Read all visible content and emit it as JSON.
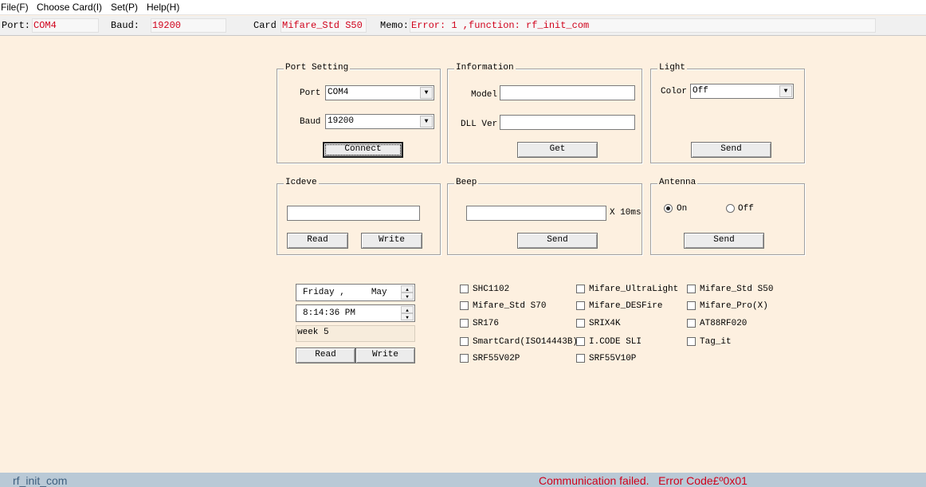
{
  "menu": [
    "File(F)",
    "Choose Card(I)",
    "Set(P)",
    "Help(H)"
  ],
  "status": {
    "port_label": "Port:",
    "port_value": "COM4",
    "baud_label": "Baud:",
    "baud_value": "19200",
    "card_label": "Card",
    "card_value": "Mifare_Std S50",
    "memo_label": "Memo:",
    "memo_value": "Error: 1 ,function: rf_init_com"
  },
  "port_setting": {
    "title": "Port Setting",
    "port_label": "Port",
    "port_value": "COM4",
    "baud_label": "Baud",
    "baud_value": "19200",
    "connect_label": "Connect"
  },
  "information": {
    "title": "Information",
    "model_label": "Model",
    "dll_label": "DLL Ver",
    "get_label": "Get"
  },
  "light": {
    "title": "Light",
    "color_label": "Color",
    "color_value": "Off",
    "send_label": "Send"
  },
  "icdeve": {
    "title": "Icdeve",
    "read_label": "Read",
    "write_label": "Write"
  },
  "beep": {
    "title": "Beep",
    "unit_label": "X 10ms",
    "send_label": "Send"
  },
  "antenna": {
    "title": "Antenna",
    "on_label": "On",
    "off_label": "Off",
    "selected": "On",
    "send_label": "Send"
  },
  "datetime": {
    "date_value": "Friday ,     May",
    "time_value": "8:14:36 PM",
    "week_value": "week 5",
    "read_label": "Read",
    "write_label": "Write"
  },
  "card_types": [
    [
      "SHC1102",
      "Mifare_UltraLight",
      "Mifare_Std S50"
    ],
    [
      "Mifare_Std S70",
      "Mifare_DESFire",
      "Mifare_Pro(X)"
    ],
    [
      "SR176",
      "SRIX4K",
      "AT88RF020"
    ],
    [
      "SmartCard(ISO14443B)",
      "I.CODE SLI",
      "Tag_it"
    ],
    [
      "SRF55V02P",
      "SRF55V10P"
    ]
  ],
  "footer": {
    "left": "rf_init_com",
    "right": "Communication failed.   Error Code£º0x01"
  },
  "colors": {
    "background": "#fdf0e0",
    "error_text": "#d0021b",
    "footer_bg": "#b9c9d6"
  }
}
